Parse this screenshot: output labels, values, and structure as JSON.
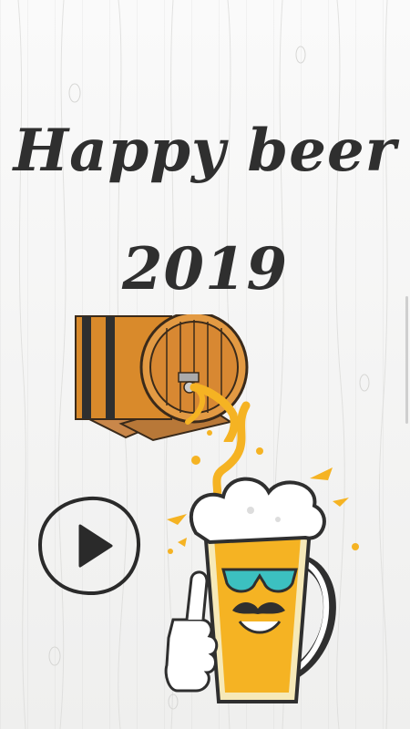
{
  "title": {
    "line1": "Happy beer",
    "line2": "2019"
  },
  "colors": {
    "ink": "#2f2f2f",
    "beer": "#f5b323",
    "barrel": "#d98a2b",
    "background": "#f4f4f2"
  },
  "icons": {
    "play": "play-icon",
    "barrel": "beer-barrel-illustration",
    "mug": "beer-mug-character-illustration"
  }
}
